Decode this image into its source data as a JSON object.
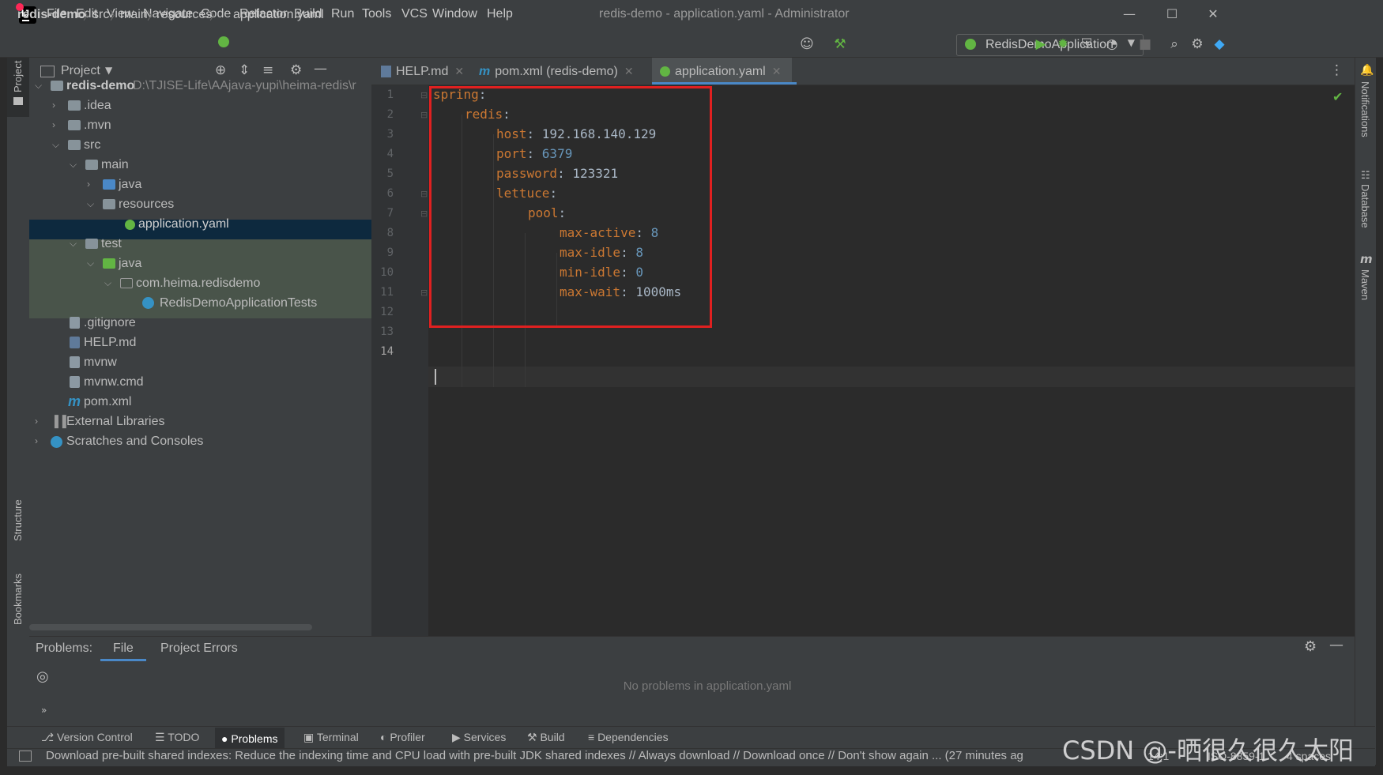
{
  "window": {
    "title": "redis-demo - application.yaml - Administrator",
    "menu": [
      "File",
      "Edit",
      "View",
      "Navigate",
      "Code",
      "Refactor",
      "Build",
      "Run",
      "Tools",
      "VCS",
      "Window",
      "Help"
    ]
  },
  "breadcrumb": [
    "redis-demo",
    "src",
    "main",
    "resources",
    "application.yaml"
  ],
  "run_config": "RedisDemoApplication",
  "project_panel": {
    "title": "Project",
    "root_name": "redis-demo",
    "root_path": "D:\\TJISE-Life\\AAjava-yupi\\heima-redis\\r",
    "items": [
      ".idea",
      ".mvn",
      "src",
      "main",
      "java",
      "resources",
      "application.yaml",
      "test",
      "java",
      "com.heima.redisdemo",
      "RedisDemoApplicationTests",
      ".gitignore",
      "HELP.md",
      "mvnw",
      "mvnw.cmd",
      "pom.xml",
      "External Libraries",
      "Scratches and Consoles"
    ]
  },
  "editor": {
    "tabs": [
      "HELP.md",
      "pom.xml (redis-demo)",
      "application.yaml"
    ],
    "active_tab": "application.yaml",
    "line_numbers": [
      "1",
      "2",
      "3",
      "4",
      "5",
      "6",
      "7",
      "8",
      "9",
      "10",
      "11",
      "12",
      "13",
      "14"
    ],
    "lines": [
      {
        "key": "spring",
        "sep": ":",
        "val": ""
      },
      {
        "key": "redis",
        "sep": ":",
        "val": ""
      },
      {
        "key": "host",
        "sep": ": ",
        "val": "192.168.140.129"
      },
      {
        "key": "port",
        "sep": ": ",
        "val": "6379"
      },
      {
        "key": "password",
        "sep": ": ",
        "val": "123321"
      },
      {
        "key": "lettuce",
        "sep": ":",
        "val": ""
      },
      {
        "key": "pool",
        "sep": ":",
        "val": ""
      },
      {
        "key": "max-active",
        "sep": ": ",
        "val": "8"
      },
      {
        "key": "max-idle",
        "sep": ": ",
        "val": "8"
      },
      {
        "key": "min-idle",
        "sep": ": ",
        "val": "0"
      },
      {
        "key": "max-wait",
        "sep": ": ",
        "val": "1000ms"
      }
    ]
  },
  "problems": {
    "label": "Problems:",
    "tabs": [
      "File",
      "Project Errors"
    ],
    "message": "No problems in application.yaml"
  },
  "left_stripe": [
    "Project",
    "Structure",
    "Bookmarks"
  ],
  "right_stripe": [
    "Notifications",
    "Database",
    "Maven"
  ],
  "bottom_tools": [
    "Version Control",
    "TODO",
    "Problems",
    "Terminal",
    "Profiler",
    "Services",
    "Build",
    "Dependencies"
  ],
  "status": {
    "message": "Download pre-built shared indexes: Reduce the indexing time and CPU load with pre-built JDK shared indexes // Always download // Download once // Don't show again ... (27 minutes ag",
    "position": "14:1",
    "encoding": "ISO-8859-1",
    "indent": "4 spaces"
  },
  "watermark": "CSDN @-晒很久很久太阳"
}
